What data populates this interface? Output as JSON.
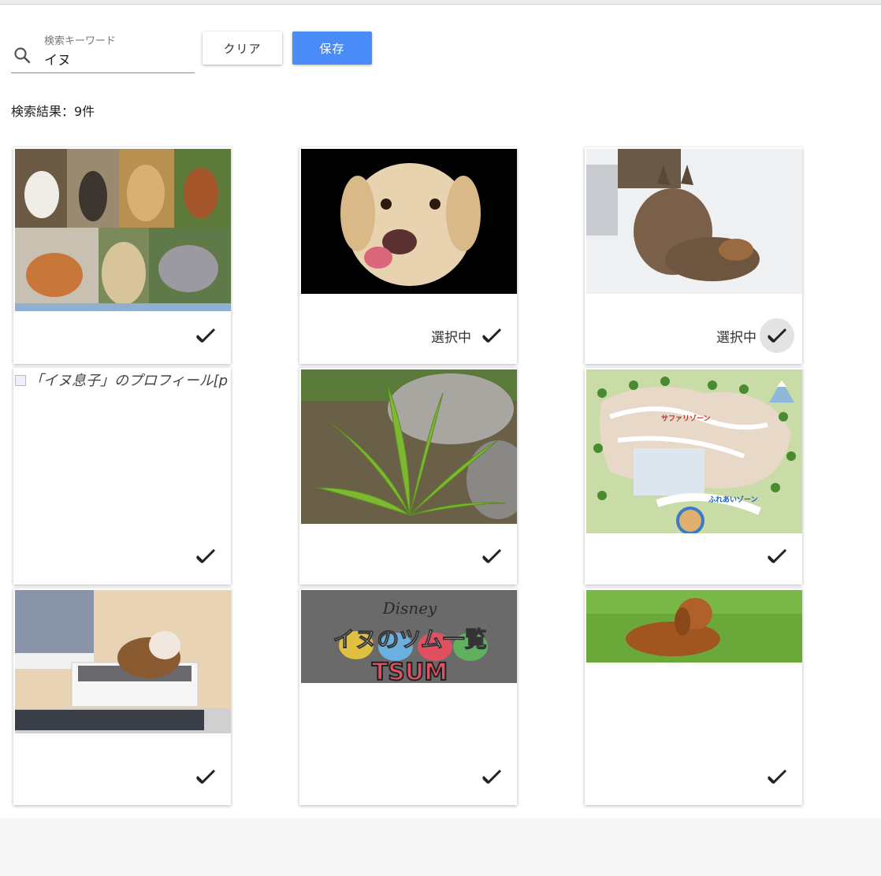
{
  "search": {
    "label": "検索キーワード",
    "value": "イヌ"
  },
  "buttons": {
    "clear": "クリア",
    "save": "保存"
  },
  "results": {
    "count_text": "検索結果：9件"
  },
  "cards": [
    {
      "selected": false,
      "selected_label": ""
    },
    {
      "selected": true,
      "selected_label": "選択中"
    },
    {
      "selected": true,
      "selected_label": "選択中"
    },
    {
      "selected": false,
      "selected_label": "",
      "alt": "「イヌ息子」のプロフィール[p"
    },
    {
      "selected": false,
      "selected_label": ""
    },
    {
      "selected": false,
      "selected_label": "",
      "map_labels": [
        "サファリゾーン",
        "ふれあいゾーン"
      ]
    },
    {
      "selected": false,
      "selected_label": ""
    },
    {
      "selected": false,
      "selected_label": "",
      "banner_top": "Disney",
      "banner_text": "イヌのツム一覧",
      "banner_bottom": "TSUM"
    },
    {
      "selected": false,
      "selected_label": ""
    }
  ],
  "icons": {
    "search": "search-icon",
    "check": "check-icon"
  },
  "colors": {
    "primary": "#4a8cf7",
    "active_bg": "#e3e3e3"
  }
}
